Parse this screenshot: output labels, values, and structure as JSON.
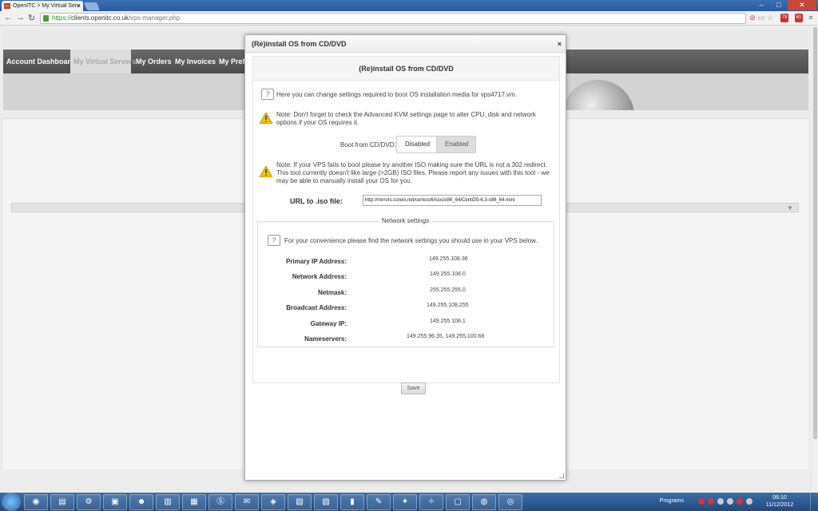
{
  "browser": {
    "tab_title": "OpenITC > My Virtual Serv",
    "tab_favicon_label": "ITC",
    "url_scheme": "https://",
    "url_host": "clients.openitc.co.uk",
    "url_path": "/vps-manager.php",
    "back_icon": "arrow-left-icon",
    "forward_icon": "arrow-right-icon",
    "reload_icon": "reload-icon",
    "ext_badge_1": "79",
    "ext_badge_2": "61"
  },
  "site_nav": {
    "items": [
      {
        "label": "Account Dashboard",
        "active": false
      },
      {
        "label": "My Virtual Servers",
        "active": true
      },
      {
        "label": "My Orders",
        "active": false
      },
      {
        "label": "My Invoices",
        "active": false
      },
      {
        "label": "My Prefe",
        "active": false
      }
    ]
  },
  "modal": {
    "title": "(Re)install OS from CD/DVD",
    "close_label": "×",
    "panel_title": "(Re)install OS from CD/DVD",
    "intro": "Here you can change settings required to boot OS installation media for vps4717.vm.",
    "note_kvm": "Note: Don't forget to check the Advanced KVM settings page to alter CPU, disk and network options if your OS requires it.",
    "boot_label": "Boot from CD/DVD:",
    "boot_options": [
      "Disabled",
      "Enabled"
    ],
    "boot_selected": "Disabled",
    "note_iso": "Note: If your VPS fails to boot please try another ISO making sure the URL is not a 302 redirect. This tool currently doesn't like large (>2GB) ISO files. Please report any issues with this tool - we may be able to manually install your OS for you.",
    "url_label": "URL to .iso file:",
    "url_value": "http://mirrors.coreix.net/centos/6/isos/x86_64/CentOS-6.3-x86_64-mini",
    "network": {
      "legend": "Network settings",
      "intro": "For your convenience please find the network settings you should use in your VPS below.",
      "rows": [
        {
          "label": "Primary IP Address:",
          "value": "149.255.108.36"
        },
        {
          "label": "Network Address:",
          "value": "149.255.108.0"
        },
        {
          "label": "Netmask:",
          "value": "255.255.255.0"
        },
        {
          "label": "Broadcast Address:",
          "value": "149.255.108.255"
        },
        {
          "label": "Gateway IP:",
          "value": "149.255.108.1"
        },
        {
          "label": "Nameservers:",
          "value": "149.255.96.35, 149.255.100.68"
        }
      ]
    },
    "save_label": "Save"
  },
  "taskbar": {
    "programs_label": "Programs",
    "time": "06:10",
    "date": "11/12/2012"
  },
  "colors": {
    "nav_bg": "#555555",
    "modal_border": "#aaaaaa",
    "warning": "#f2c200",
    "taskbar": "#2b5a92"
  }
}
